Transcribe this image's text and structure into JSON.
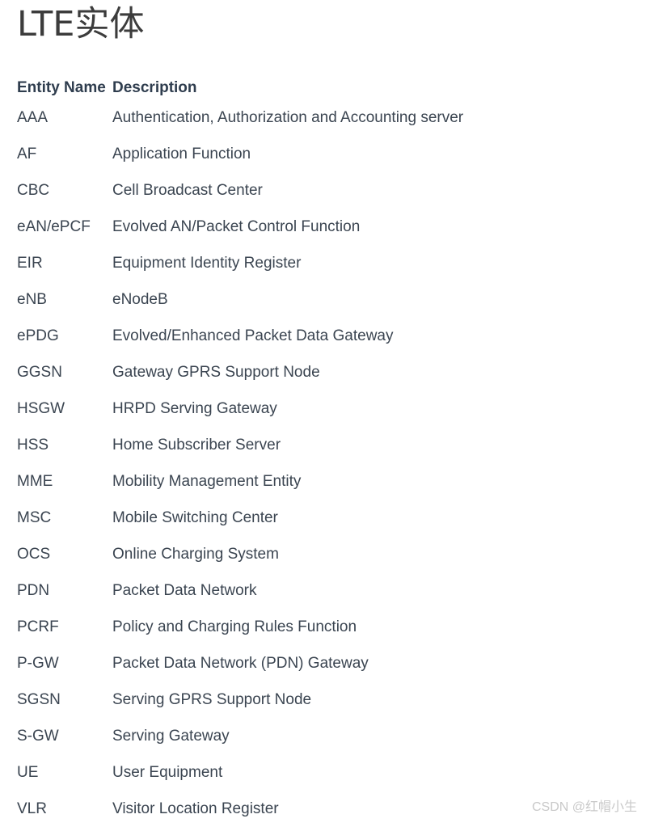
{
  "page": {
    "title": "LTE实体",
    "background_color": "#ffffff",
    "title_color": "#3c3c3c",
    "text_color": "#3b4551",
    "header_color": "#2f3d4e"
  },
  "table": {
    "headers": {
      "name": "Entity Name",
      "description": "Description",
      "combined": "Entity NameDescription"
    },
    "rows": [
      {
        "name": "AAA",
        "description": "Authentication, Authorization and Accounting server"
      },
      {
        "name": "AF",
        "description": "Application Function"
      },
      {
        "name": "CBC",
        "description": "Cell Broadcast Center"
      },
      {
        "name": "eAN/ePCF",
        "description": "Evolved AN/Packet Control Function"
      },
      {
        "name": "EIR",
        "description": "Equipment Identity Register"
      },
      {
        "name": "eNB",
        "description": "eNodeB"
      },
      {
        "name": "ePDG",
        "description": "Evolved/Enhanced Packet Data Gateway"
      },
      {
        "name": "GGSN",
        "description": "Gateway GPRS Support Node"
      },
      {
        "name": "HSGW",
        "description": "HRPD Serving Gateway"
      },
      {
        "name": "HSS",
        "description": "Home Subscriber Server"
      },
      {
        "name": "MME",
        "description": "Mobility Management Entity"
      },
      {
        "name": "MSC",
        "description": "Mobile Switching Center"
      },
      {
        "name": "OCS",
        "description": "Online Charging System"
      },
      {
        "name": "PDN",
        "description": "Packet Data Network"
      },
      {
        "name": "PCRF",
        "description": "Policy and Charging Rules Function"
      },
      {
        "name": "P-GW",
        "description": "Packet Data Network (PDN) Gateway"
      },
      {
        "name": "SGSN",
        "description": "Serving GPRS Support Node"
      },
      {
        "name": "S-GW",
        "description": "Serving Gateway"
      },
      {
        "name": "UE",
        "description": "User Equipment"
      },
      {
        "name": "VLR",
        "description": "Visitor Location Register"
      }
    ]
  },
  "watermark": {
    "text": "CSDN @红帽小生",
    "color": "#c9c9c9"
  }
}
